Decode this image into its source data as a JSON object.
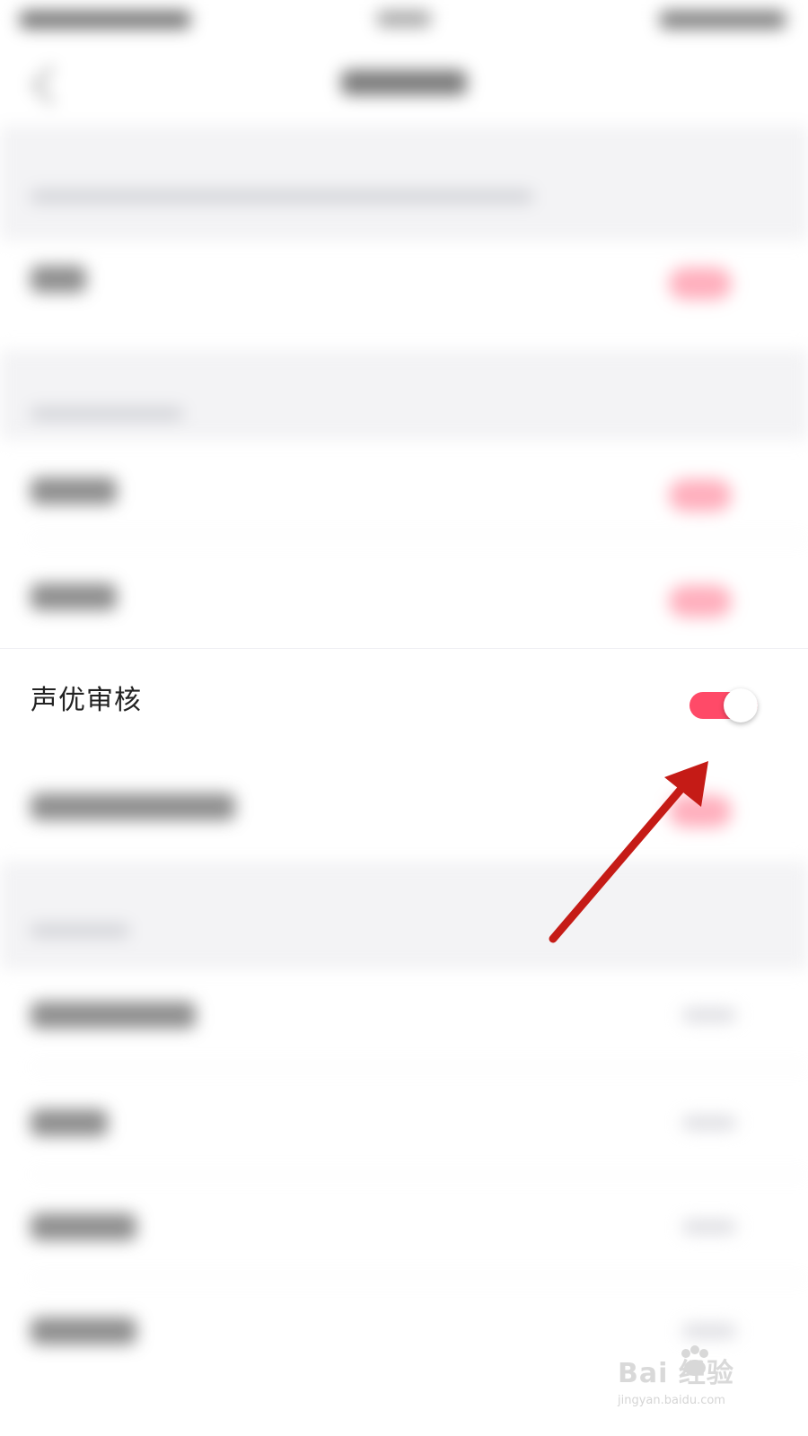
{
  "focused_setting": {
    "label": "声优审核",
    "toggle_state": "on"
  },
  "colors": {
    "accent_pink": "#ff4a68",
    "annotation_arrow": "#c51b16"
  },
  "watermark": {
    "brand": "Bai 经验",
    "site": "jingyan.baidu.com"
  }
}
